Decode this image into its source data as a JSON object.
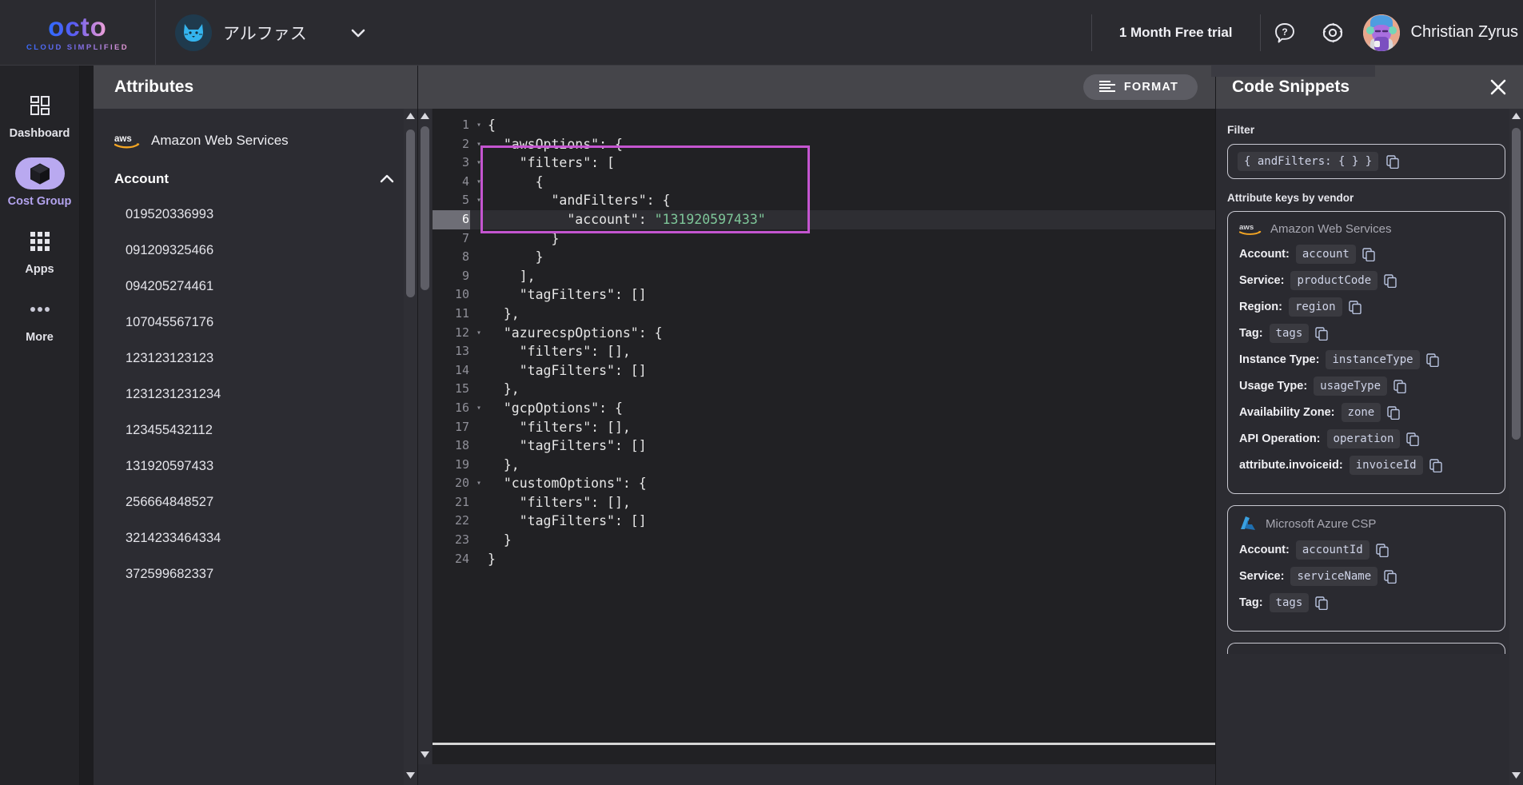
{
  "topbar": {
    "logo_word": "octo",
    "logo_tagline": "CLOUD SIMPLIFIED",
    "org_name": "アルファス",
    "org_avatar_icon": "cat-face-icon",
    "org_chevron_icon": "chevron-down-icon",
    "trial_label": "1 Month Free trial",
    "help_icon": "help-question-icon",
    "settings_icon": "gear-icon",
    "user_avatar_icon": "user-avatar",
    "user_name": "Christian Zyrus"
  },
  "rail": {
    "items": [
      {
        "label": "Dashboard",
        "icon": "dashboard-grid-icon",
        "active": false
      },
      {
        "label": "Cost Group",
        "icon": "cube-box-icon",
        "active": true
      },
      {
        "label": "Apps",
        "icon": "apps-grid-icon",
        "active": false
      },
      {
        "label": "More",
        "icon": "ellipsis-icon",
        "active": false
      }
    ]
  },
  "attributes": {
    "title": "Attributes",
    "vendor": "Amazon Web Services",
    "vendor_icon": "aws-logo-icon",
    "group_label": "Account",
    "group_chevron": "chevron-up-icon",
    "accounts": [
      "019520336993",
      "091209325466",
      "094205274461",
      "107045567176",
      "123123123123",
      "1231231231234",
      "123455432112",
      "131920597433",
      "256664848527",
      "3214233464334",
      "372599682337"
    ]
  },
  "editor": {
    "format_label": "FORMAT",
    "format_icon": "format-lines-icon",
    "current_line": 6,
    "highlight_color": "#c455d0",
    "lines": [
      {
        "n": 1,
        "fold": true,
        "text": "{"
      },
      {
        "n": 2,
        "fold": true,
        "text": "  \"awsOptions\": {"
      },
      {
        "n": 3,
        "fold": true,
        "text": "    \"filters\": ["
      },
      {
        "n": 4,
        "fold": true,
        "text": "      {"
      },
      {
        "n": 5,
        "fold": true,
        "text": "        \"andFilters\": {"
      },
      {
        "n": 6,
        "fold": false,
        "text": "          \"account\": ",
        "value": "\"131920597433\""
      },
      {
        "n": 7,
        "fold": false,
        "text": "        }"
      },
      {
        "n": 8,
        "fold": false,
        "text": "      }"
      },
      {
        "n": 9,
        "fold": false,
        "text": "    ],"
      },
      {
        "n": 10,
        "fold": false,
        "text": "    \"tagFilters\": []"
      },
      {
        "n": 11,
        "fold": false,
        "text": "  },"
      },
      {
        "n": 12,
        "fold": true,
        "text": "  \"azurecspOptions\": {"
      },
      {
        "n": 13,
        "fold": false,
        "text": "    \"filters\": [],"
      },
      {
        "n": 14,
        "fold": false,
        "text": "    \"tagFilters\": []"
      },
      {
        "n": 15,
        "fold": false,
        "text": "  },"
      },
      {
        "n": 16,
        "fold": true,
        "text": "  \"gcpOptions\": {"
      },
      {
        "n": 17,
        "fold": false,
        "text": "    \"filters\": [],"
      },
      {
        "n": 18,
        "fold": false,
        "text": "    \"tagFilters\": []"
      },
      {
        "n": 19,
        "fold": false,
        "text": "  },"
      },
      {
        "n": 20,
        "fold": true,
        "text": "  \"customOptions\": {"
      },
      {
        "n": 21,
        "fold": false,
        "text": "    \"filters\": [],"
      },
      {
        "n": 22,
        "fold": false,
        "text": "    \"tagFilters\": []"
      },
      {
        "n": 23,
        "fold": false,
        "text": "  }"
      },
      {
        "n": 24,
        "fold": false,
        "text": "}"
      }
    ]
  },
  "snippets": {
    "title": "Code Snippets",
    "close_icon": "close-icon",
    "filter_label": "Filter",
    "filter_snippet": "{ andFilters: { } }",
    "section_label": "Attribute keys by vendor",
    "vendors": [
      {
        "name": "Amazon Web Services",
        "icon": "aws-logo-icon",
        "keys": [
          {
            "label": "Account:",
            "value": "account"
          },
          {
            "label": "Service:",
            "value": "productCode"
          },
          {
            "label": "Region:",
            "value": "region"
          },
          {
            "label": "Tag:",
            "value": "tags"
          },
          {
            "label": "Instance Type:",
            "value": "instanceType"
          },
          {
            "label": "Usage Type:",
            "value": "usageType"
          },
          {
            "label": "Availability Zone:",
            "value": "zone"
          },
          {
            "label": "API Operation:",
            "value": "operation"
          },
          {
            "label": "attribute.invoiceid:",
            "value": "invoiceId"
          }
        ]
      },
      {
        "name": "Microsoft Azure CSP",
        "icon": "azure-logo-icon",
        "keys": [
          {
            "label": "Account:",
            "value": "accountId"
          },
          {
            "label": "Service:",
            "value": "serviceName"
          },
          {
            "label": "Tag:",
            "value": "tags"
          }
        ]
      }
    ]
  }
}
